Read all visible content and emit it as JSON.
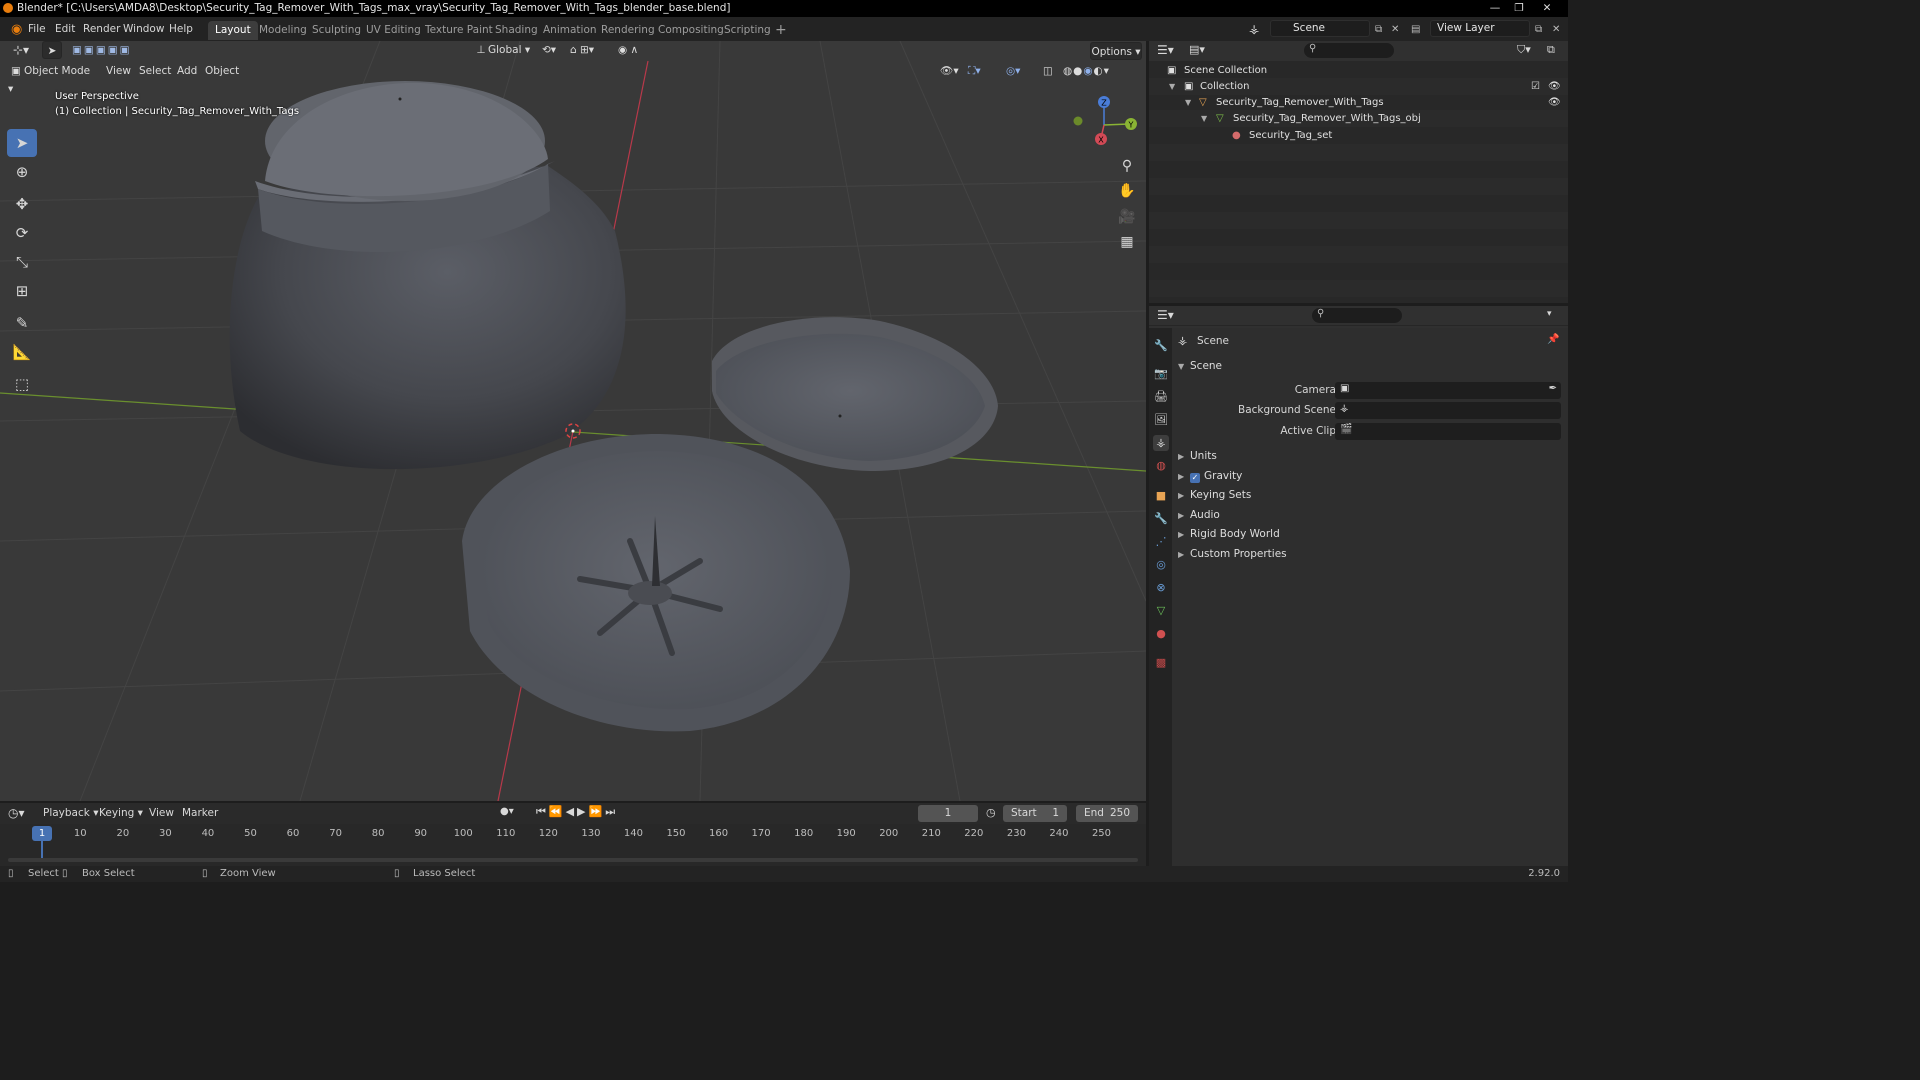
{
  "window": {
    "title": "Blender* [C:\\Users\\AMDA8\\Desktop\\Security_Tag_Remover_With_Tags_max_vray\\Security_Tag_Remover_With_Tags_blender_base.blend]",
    "controls": [
      "—",
      "❐",
      "✕"
    ]
  },
  "menubar": {
    "menus": [
      "File",
      "Edit",
      "Render",
      "Window",
      "Help"
    ],
    "workspaces": [
      "Layout",
      "Modeling",
      "Sculpting",
      "UV Editing",
      "Texture Paint",
      "Shading",
      "Animation",
      "Rendering",
      "Compositing",
      "Scripting"
    ],
    "active_workspace": "Layout",
    "add_workspace": "+",
    "scene_value": "Scene",
    "view_layer_value": "View Layer"
  },
  "viewport_header": {
    "mode": "Object Mode",
    "menus": [
      "View",
      "Select",
      "Add",
      "Object"
    ],
    "transform_orientation": "Global",
    "options_label": "Options"
  },
  "viewport": {
    "perspective_label": "User Perspective",
    "collection_label": "(1) Collection | Security_Tag_Remover_With_Tags",
    "gizmo_axes": [
      "X",
      "Y",
      "Z"
    ]
  },
  "outliner": {
    "root": "Scene Collection",
    "items": [
      {
        "label": "Collection",
        "indent": 1
      },
      {
        "label": "Security_Tag_Remover_With_Tags",
        "indent": 2
      },
      {
        "label": "Security_Tag_Remover_With_Tags_obj",
        "indent": 3
      },
      {
        "label": "Security_Tag_set",
        "indent": 4
      }
    ]
  },
  "properties": {
    "context_title": "Scene",
    "panel_title": "Scene",
    "fields": {
      "camera_label": "Camera",
      "background_scene_label": "Background Scene",
      "active_clip_label": "Active Clip"
    },
    "subpanels": [
      "Units",
      "Gravity",
      "Keying Sets",
      "Audio",
      "Rigid Body World",
      "Custom Properties"
    ],
    "gravity_checked": true
  },
  "timeline": {
    "menus": [
      "Playback",
      "Keying",
      "View",
      "Marker"
    ],
    "current_frame": "1",
    "start_label": "Start",
    "start_value": "1",
    "end_label": "End",
    "end_value": "250",
    "ruler_ticks": [
      "1",
      "10",
      "20",
      "30",
      "40",
      "50",
      "60",
      "70",
      "80",
      "90",
      "100",
      "110",
      "120",
      "130",
      "140",
      "150",
      "160",
      "170",
      "180",
      "190",
      "200",
      "210",
      "220",
      "230",
      "240",
      "250"
    ]
  },
  "statusbar": {
    "select": "Select",
    "box_select": "Box Select",
    "zoom_view": "Zoom View",
    "lasso_select": "Lasso Select",
    "version": "2.92.0"
  },
  "colors": {
    "accent": "#4772b3",
    "viewport_bg": "#393939",
    "x_axis": "#c53a4a",
    "y_axis": "#6fa02a",
    "blender_orange": "#e87d0d"
  }
}
